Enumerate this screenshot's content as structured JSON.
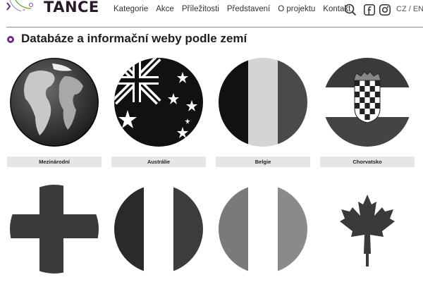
{
  "header": {
    "logo_text": "TANCE",
    "nav": [
      "Kategorie",
      "Akce",
      "Příležitosti",
      "Představení",
      "O projektu",
      "Kontakt"
    ],
    "lang": "CZ / EN"
  },
  "icons": [
    "search-icon",
    "facebook-icon",
    "instagram-icon"
  ],
  "page": {
    "title": "Databáze a informační weby podle zemí"
  },
  "countries": [
    {
      "label": "Mezinárodní"
    },
    {
      "label": "Austrálie"
    },
    {
      "label": "Belgie"
    },
    {
      "label": "Chorvatsko"
    }
  ],
  "colors": {
    "accent": "#6c2d7a",
    "caption_bg": "#e6e6e6"
  }
}
